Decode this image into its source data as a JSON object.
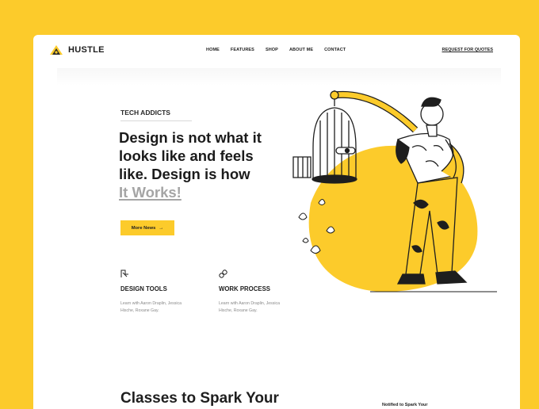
{
  "brand": {
    "name": "HUSTLE"
  },
  "nav": {
    "links": [
      "HOME",
      "FEATURES",
      "SHOP",
      "ABOUT ME",
      "CONTACT"
    ],
    "cta": "REQUEST FOR QUOTES"
  },
  "hero": {
    "eyebrow": "TECH ADDICTS",
    "headline_lines": [
      "Design is not what it",
      "looks like and feels",
      "like. Design is how"
    ],
    "headline_link": "It Works!",
    "button_label": "More News",
    "button_arrow": "→"
  },
  "features": [
    {
      "icon": "pen-tool-icon",
      "title": "DESIGN TOOLS",
      "desc_lines": [
        "Learn with Aaron Draplin, Jessica",
        "Hische, Roxane Gay."
      ]
    },
    {
      "icon": "link-icon",
      "title": "WORK PROCESS",
      "desc_lines": [
        "Learn with Aaron Draplin, Jessica",
        "Hische, Roxane Gay."
      ]
    }
  ],
  "section": {
    "title": "Classes to Spark Your",
    "side_note": "Notified to Spark Your"
  },
  "colors": {
    "accent": "#fccb2b",
    "text": "#1b1b1b",
    "muted": "#a5a5a5"
  }
}
